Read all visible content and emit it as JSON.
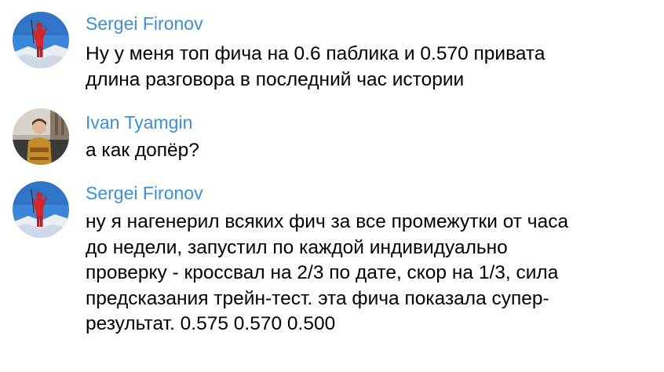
{
  "colors": {
    "author_name": "#3d8fd0",
    "message_text": "#000000",
    "background": "#ffffff"
  },
  "messages": [
    {
      "author": "Sergei Fironov",
      "avatar_icon": "climber-on-summit-photo",
      "lines": [
        "Ну у меня топ фича на 0.6 паблика и 0.570 привата",
        "длина разговора в последний час истории"
      ]
    },
    {
      "author": "Ivan Tyamgin",
      "avatar_icon": "person-portrait-photo",
      "lines": [
        "а как допёр?"
      ]
    },
    {
      "author": "Sergei Fironov",
      "avatar_icon": "climber-on-summit-photo",
      "lines": [
        "ну я нагенерил всяких фич за все промежутки от часа",
        "до недели, запустил по каждой индивидуально",
        "проверку - кроссвал на 2/3 по дате, скор на 1/3, сила",
        "предсказания трейн-тест. эта фича показала супер-",
        "результат. 0.575 0.570 0.500"
      ]
    }
  ]
}
